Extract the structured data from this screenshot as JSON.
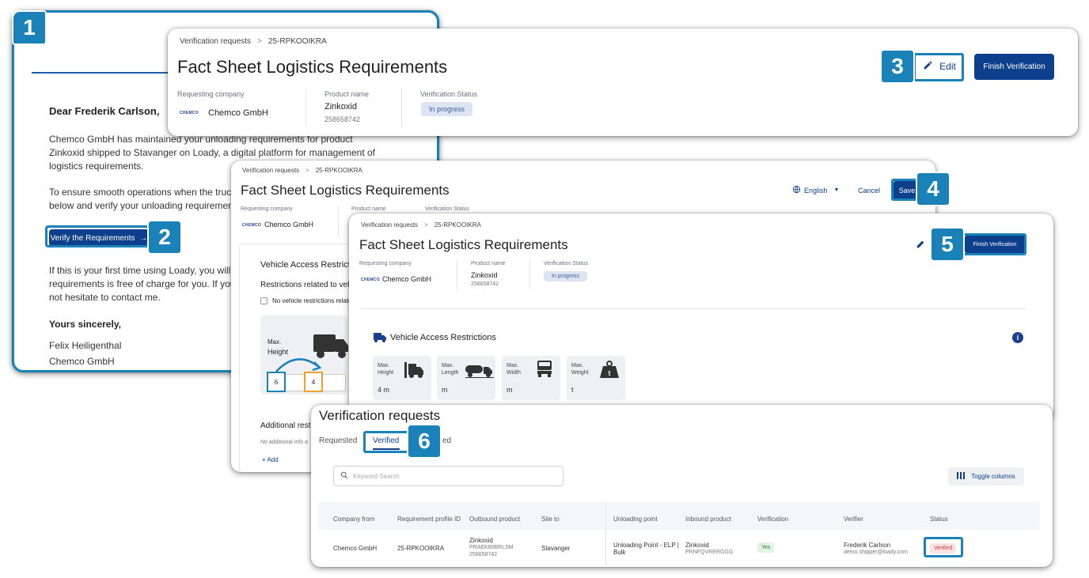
{
  "badges": [
    "1",
    "2",
    "3",
    "4",
    "5",
    "6"
  ],
  "email": {
    "greeting": "Dear Frederik Carlson,",
    "p1": "Chemco GmbH has maintained your unloading requirements for product Zinkoxid shipped to Stavanger on Loady, a digital platform for management of logistics requirements.",
    "p2a": "To ensure smooth operations when the truck",
    "p2b": "below and verify your unloading requirement",
    "cta": "Verify the Requirements",
    "cta_arrow": "→",
    "p3a": "If this is your first time using Loady, you will",
    "p3b": "requirements is free of charge for you. If you",
    "p3c": "not hesitate to contact me.",
    "closing": "Yours sincerely,",
    "sender": "Felix Heiligenthal",
    "company": "Chemco GmbH"
  },
  "card3": {
    "crumb1": "Verification requests",
    "crumb2": "25-RPKOOIKRA",
    "title": "Fact Sheet Logistics Requirements",
    "edit": "Edit",
    "finish": "Finish Verification",
    "lbl_company": "Requesting company",
    "company": "Chemco GmbH",
    "logo": "CHEMCO",
    "lbl_product": "Product name",
    "product": "Zinkoxid",
    "product_id": "258658742",
    "lbl_status": "Verification Status",
    "status": "In progress"
  },
  "card4": {
    "crumb1": "Verification requests",
    "crumb2": "25-RPKOOIKRA",
    "title": "Fact Sheet Logistics Requirements",
    "lang": "English",
    "cancel": "Cancel",
    "save": "Save",
    "lbl_company": "Requesting company",
    "lbl_product": "Product name",
    "lbl_status": "Verification Status",
    "company": "Chemco GmbH",
    "logo": "CHEMCO",
    "section": "Vehicle Access Restrict",
    "restrictions": "Restrictions related to vehi",
    "checkbox": "No vehicle restrictions relate",
    "max": "Max.",
    "height": "Height",
    "field1": "6",
    "field2": "4",
    "additional": "Additional restri",
    "no_info": "No additional info a",
    "add": "+ Add"
  },
  "card5": {
    "crumb1": "Verification requests",
    "crumb2": "25-RPKOOIKRA",
    "title": "Fact Sheet Logistics Requirements",
    "finish": "Finish Verification",
    "lbl_company": "Requesting company",
    "company": "Chemco GmbH",
    "logo": "CHEMCO",
    "lbl_product": "Product name",
    "product": "Zinkoxid",
    "product_id": "258658742",
    "lbl_status": "Verification Status",
    "status": "In progress",
    "section": "Vehicle Access Restrictions",
    "tiles": [
      {
        "l1": "Max.",
        "l2": "Height",
        "v": "4 m"
      },
      {
        "l1": "Max.",
        "l2": "Length",
        "v": "m"
      },
      {
        "l1": "Max.",
        "l2": "Width",
        "v": "m"
      },
      {
        "l1": "Max.",
        "l2": "Weight",
        "v": "t"
      }
    ]
  },
  "card6": {
    "title": "Verification requests",
    "tabs": [
      "Requested",
      "Verified",
      "ed"
    ],
    "search_placeholder": "Keyword Search",
    "toggle": "Toggle columns",
    "columns": [
      "Company from",
      "Requirement profile ID",
      "Outbound product",
      "Site to",
      "Unloading point",
      "Inbound product",
      "Verification",
      "Verifier",
      "Status"
    ],
    "row": {
      "company": "Chemco GmbH",
      "profile": "25-RPKOOIKRA",
      "out1": "Zinkoxid",
      "out2": "PRAEK80BRLSM",
      "out3": "258658742",
      "site": "Stavanger",
      "up1": "Unloading Point - ELP |",
      "up2": "Bulk",
      "in1": "Zinkoxid",
      "in2": "PRNFQVRERGGG",
      "verification": "Yes",
      "ver1": "Frederik Carlson",
      "ver2": "demo.shipper@loady.com",
      "status": "Verified"
    }
  },
  "colors": {
    "accent": "#1a82b8",
    "primary": "#0d3f8c",
    "orange": "#f0a12b",
    "verified_red": "#d23c3c"
  }
}
